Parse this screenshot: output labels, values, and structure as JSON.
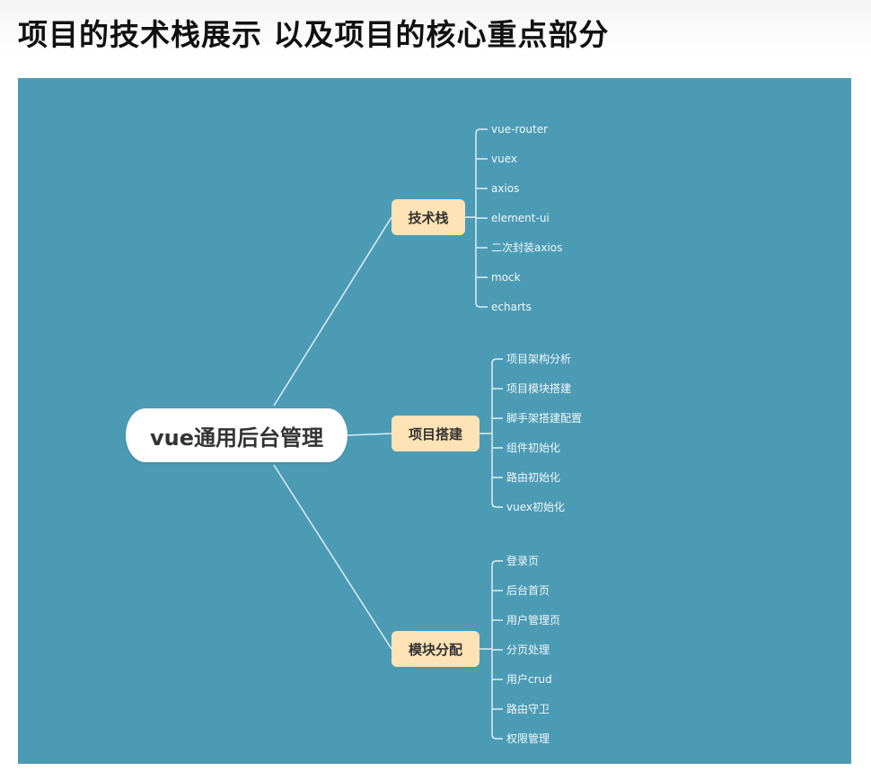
{
  "title": "项目的技术栈展示 以及项目的核心重点部分",
  "colors": {
    "panel": "#4b9bb5",
    "branch": "#fde3b5",
    "root": "#ffffff",
    "line": "#dfeef4"
  },
  "mindmap": {
    "root": "vue通用后台管理",
    "branches": [
      {
        "label": "技术栈",
        "items": [
          "vue-router",
          "vuex",
          "axios",
          "element-ui",
          "二次封装axios",
          "mock",
          "echarts"
        ]
      },
      {
        "label": "项目搭建",
        "items": [
          "项目架构分析",
          "项目模块搭建",
          "脚手架搭建配置",
          "组件初始化",
          "路由初始化",
          "vuex初始化"
        ]
      },
      {
        "label": "模块分配",
        "items": [
          "登录页",
          "后台首页",
          "用户管理页",
          "分页处理",
          "用户crud",
          "路由守卫",
          "权限管理"
        ]
      }
    ]
  }
}
